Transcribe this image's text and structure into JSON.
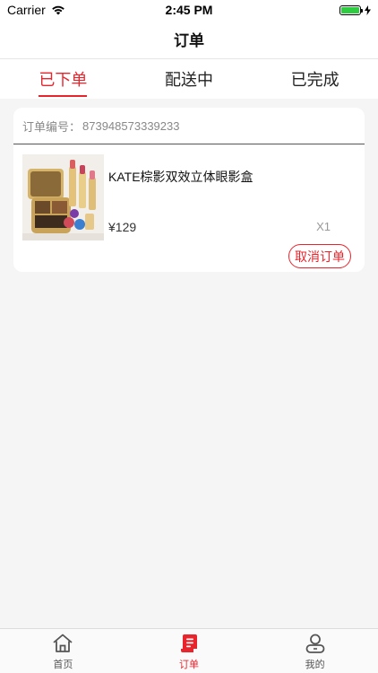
{
  "status_bar": {
    "carrier": "Carrier",
    "time": "2:45 PM",
    "battery_level": 1.0,
    "battery_color": "#2ecc40"
  },
  "nav": {
    "title": "订单"
  },
  "tabs": [
    {
      "label": "已下单",
      "active": true
    },
    {
      "label": "配送中",
      "active": false
    },
    {
      "label": "已完成",
      "active": false
    }
  ],
  "order": {
    "number_label": "订单编号：",
    "number": "873948573339233",
    "item": {
      "name": "KATE棕影双效立体眼影盒",
      "price": "¥129",
      "quantity": "X1",
      "image_icon": "cosmetics-palette-image"
    },
    "cancel_label": "取消订单"
  },
  "tabbar": [
    {
      "label": "首页",
      "icon": "home-icon",
      "active": false
    },
    {
      "label": "订单",
      "icon": "order-icon",
      "active": true
    },
    {
      "label": "我的",
      "icon": "profile-icon",
      "active": false
    }
  ],
  "colors": {
    "accent": "#e8252d",
    "background": "#f5f5f5"
  }
}
